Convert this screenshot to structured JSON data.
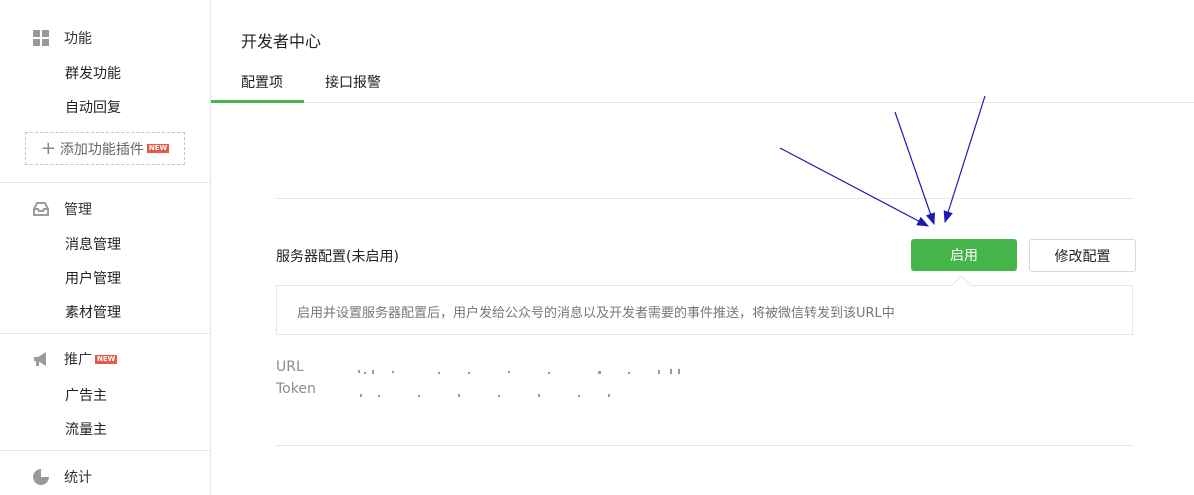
{
  "sidebar": {
    "function": {
      "title": "功能",
      "items": [
        "群发功能",
        "自动回复"
      ],
      "add_plugin": "添加功能插件",
      "badge": "NEW"
    },
    "manage": {
      "title": "管理",
      "items": [
        "消息管理",
        "用户管理",
        "素材管理"
      ]
    },
    "promote": {
      "title": "推广",
      "badge": "NEW",
      "items": [
        "广告主",
        "流量主"
      ]
    },
    "stats": {
      "title": "统计"
    }
  },
  "main": {
    "title": "开发者中心",
    "tabs": [
      {
        "label": "配置项",
        "active": true
      },
      {
        "label": "接口报警",
        "active": false
      }
    ],
    "server": {
      "label": "服务器配置(未启用)",
      "enable_button": "启用",
      "modify_button": "修改配置",
      "tip": "启用并设置服务器配置后，用户发给公众号的消息以及开发者需要的事件推送，将被微信转发到该URL中",
      "url_label": "URL",
      "token_label": "Token"
    }
  },
  "colors": {
    "accent": "#44b549",
    "badge": "#e75846",
    "annotation_arrow": "#1a1ab8"
  }
}
